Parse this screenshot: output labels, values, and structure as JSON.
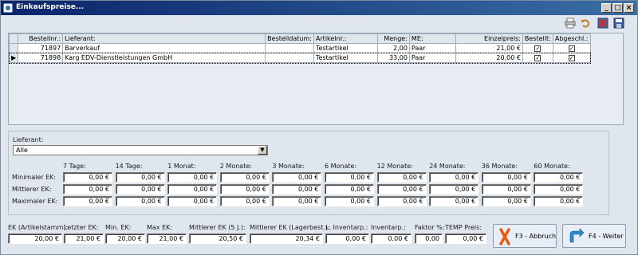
{
  "window": {
    "title": "Einkaufspreise...",
    "minimize": "_",
    "maximize": "□",
    "close": "×"
  },
  "toolbar": {
    "icons": [
      "printer-icon",
      "undo-icon",
      "delete-icon",
      "save-icon"
    ]
  },
  "table": {
    "columns": [
      "Bestellnr.:",
      "Lieferant:",
      "Bestelldatum:",
      "Artikelnr.:",
      "Menge:",
      "ME:",
      "Einzelpreis:",
      "Bestellt:",
      "Abgeschl.:"
    ],
    "rows": [
      {
        "indicator": "",
        "bestellnr": "71897",
        "lieferant": "Barverkauf",
        "bestelldatum": "",
        "artikelnr": "Testartikel",
        "menge": "2,00",
        "me": "Paar",
        "einzelpreis": "21,00 €",
        "bestellt": true,
        "abgeschl": true
      },
      {
        "indicator": "▶",
        "bestellnr": "71898",
        "lieferant": "Karg EDV-Dienstleistungen GmbH",
        "bestelldatum": "",
        "artikelnr": "Testartikel",
        "menge": "33,00",
        "me": "Paar",
        "einzelpreis": "20,00 €",
        "bestellt": true,
        "abgeschl": true
      }
    ]
  },
  "lieferant": {
    "label": "Lieferant:",
    "selected": "Alle"
  },
  "stats": {
    "periods": [
      "7 Tage:",
      "14 Tage:",
      "1 Monat:",
      "2 Monate:",
      "3 Monate:",
      "6 Monate:",
      "12 Monate:",
      "24 Monate:",
      "36 Monate:",
      "60 Monate:"
    ],
    "row_labels": [
      "Minimaler EK:",
      "Mittlerer EK:",
      "Maximaler EK:"
    ],
    "values": [
      [
        "0,00 €",
        "0,00 €",
        "0,00 €",
        "0,00 €",
        "0,00 €",
        "0,00 €",
        "0,00 €",
        "0,00 €",
        "0,00 €",
        "0,00 €"
      ],
      [
        "0,00 €",
        "0,00 €",
        "0,00 €",
        "0,00 €",
        "0,00 €",
        "0,00 €",
        "0,00 €",
        "0,00 €",
        "0,00 €",
        "0,00 €"
      ],
      [
        "0,00 €",
        "0,00 €",
        "0,00 €",
        "0,00 €",
        "0,00 €",
        "0,00 €",
        "0,00 €",
        "0,00 €",
        "0,00 €",
        "0,00 €"
      ]
    ]
  },
  "summary": {
    "fields": [
      {
        "label": "EK (Artikelstamm):",
        "value": "20,00 €"
      },
      {
        "label": "Letzter EK:",
        "value": "21,00 €"
      },
      {
        "label": "Min. EK:",
        "value": "20,00 €"
      },
      {
        "label": "Max EK:",
        "value": "21,00 €"
      },
      {
        "label": "Mittlerer EK (5 J.):",
        "value": "20,50 €"
      },
      {
        "label": "Mittlerer EK (Lagerbest.):",
        "value": "20,34 €"
      },
      {
        "label": "L. Inventarp.:",
        "value": "0,00 €"
      },
      {
        "label": "Inventarp.:",
        "value": "0,00 €"
      },
      {
        "label": "Faktor %:",
        "value": "0,00"
      },
      {
        "label": "TEMP Preis:",
        "value": "0,00 €"
      }
    ]
  },
  "buttons": {
    "abbruch": "F3 - Abbruch",
    "weiter": "F4 - Weiter"
  },
  "colors": {
    "titlebar_start": "#0a246a",
    "titlebar_end": "#3a6ea5",
    "window_bg": "#dfe6ee",
    "abbruch_icon": "#e85a10",
    "weiter_icon": "#2a8ad0"
  }
}
